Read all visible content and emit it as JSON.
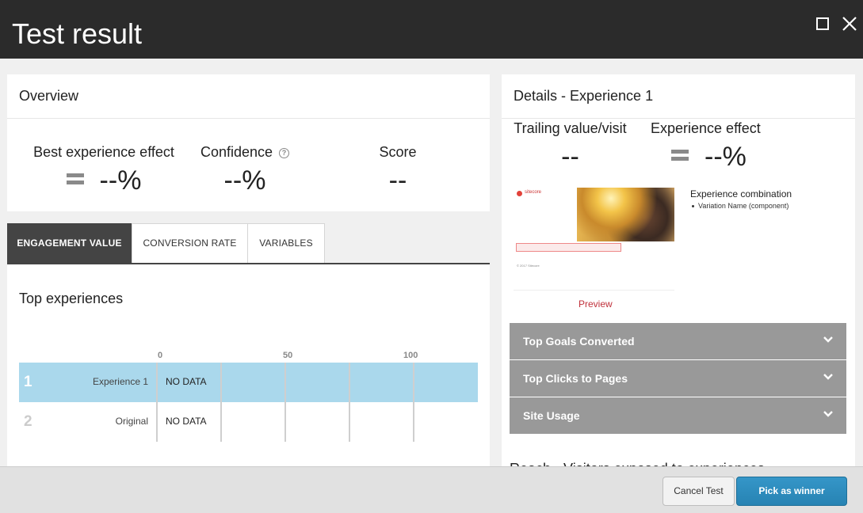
{
  "window": {
    "title": "Test result"
  },
  "overview": {
    "heading": "Overview",
    "best_effect": {
      "label": "Best experience effect",
      "value": "--%"
    },
    "confidence": {
      "label": "Confidence",
      "value": "--%",
      "help": "?"
    },
    "score": {
      "label": "Score",
      "value": "--"
    }
  },
  "tabs": [
    {
      "label": "ENGAGEMENT VALUE",
      "active": true
    },
    {
      "label": "CONVERSION RATE",
      "active": false
    },
    {
      "label": "VARIABLES",
      "active": false
    }
  ],
  "top_experiences": {
    "heading": "Top experiences",
    "axis_ticks": [
      "0",
      "50",
      "100"
    ],
    "rows": [
      {
        "rank": "1",
        "name": "Experience 1",
        "value": "NO DATA",
        "selected": true
      },
      {
        "rank": "2",
        "name": "Original",
        "value": "NO DATA",
        "selected": false
      }
    ]
  },
  "details": {
    "heading": "Details - Experience 1",
    "trailing": {
      "label": "Trailing value/visit",
      "value": "--"
    },
    "effect": {
      "label": "Experience effect",
      "value": "--%"
    },
    "thumbnail": {
      "brand": "sitecore",
      "footer": "© 2017 Sitecore"
    },
    "combination_title": "Experience combination",
    "combination_items": [
      "Variation Name (component)"
    ],
    "preview_label": "Preview",
    "accordions": [
      {
        "label": "Top Goals Converted"
      },
      {
        "label": "Top Clicks to Pages"
      },
      {
        "label": "Site Usage"
      }
    ],
    "reach_label": "Reach - Visitors exposed to experiences"
  },
  "footer": {
    "cancel_label": "Cancel Test",
    "pick_label": "Pick as winner"
  },
  "colors": {
    "titlebar": "#2b2b2b",
    "selected_row": "#aad8ec",
    "accordion": "#999999",
    "primary_button": "#2d8ab9",
    "preview_link": "#c0313b"
  }
}
